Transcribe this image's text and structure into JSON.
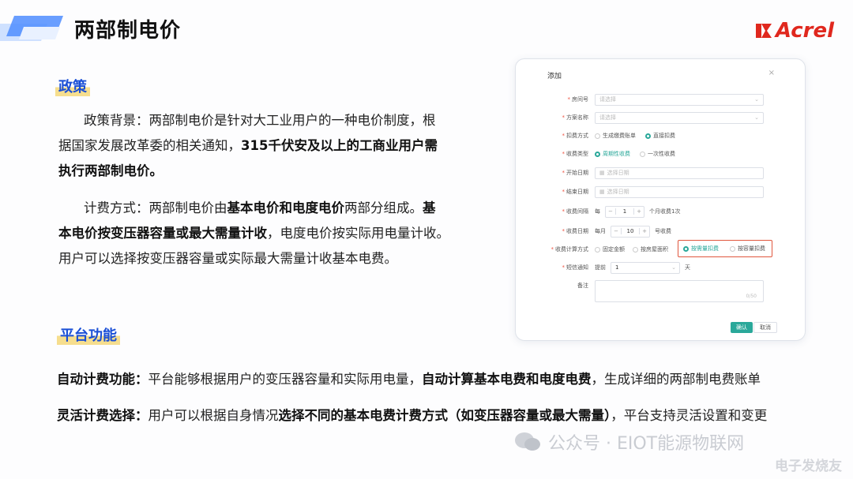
{
  "page": {
    "title": "两部制电价",
    "logo": "Acrel"
  },
  "policy": {
    "label": "政策",
    "p1_l1": "政策背景：两部制电价是针对大工业用户的一种电价制度，根",
    "p1_l2a": "据国家发展改革委的相关通知，",
    "p1_l2b": "315千伏安及以上的工商业用户需",
    "p1_l3": "执行两部制电价。",
    "p2_l1a": "计费方式：两部制电价由",
    "p2_l1b": "基本电价和电度电价",
    "p2_l1c": "两部分组成。",
    "p2_l1d": "基",
    "p2_l2a": "本电价按变压器容量或最大需量计收",
    "p2_l2b": "，电度电价按实际用电量计收。",
    "p2_l3": "用户可以选择按变压器容量或实际最大需量计收基本电费。"
  },
  "platform": {
    "label": "平台功能",
    "f1a": "自动计费功能：",
    "f1b": "平台能够根据用户的变压器容量和实际用电量，",
    "f1c": "自动计算基本电费和电度电费",
    "f1d": "，生成详细的两部制电费账单",
    "f2a": "灵活计费选择：",
    "f2b": "用户可以根据自身情况",
    "f2c": "选择不同的基本电费计费方式（如变压器容量或最大需量）",
    "f2d": "，平台支持灵活设置和变更"
  },
  "form": {
    "title": "添加",
    "close": "×",
    "room_label": "房间号",
    "room_placeholder": "请选择",
    "plan_label": "方案名称",
    "plan_placeholder": "请选择",
    "deduct_label": "扣费方式",
    "deduct_opt1": "生成缴费账单",
    "deduct_opt2": "直接扣费",
    "type_label": "收费类型",
    "type_opt1": "周期性收费",
    "type_opt2": "一次性收费",
    "start_label": "开始日期",
    "start_placeholder": "选择日期",
    "end_label": "结束日期",
    "end_placeholder": "选择日期",
    "interval_label": "收费间隔",
    "interval_prefix": "每",
    "interval_value": "1",
    "interval_suffix": "个月收费1次",
    "day_label": "收费日期",
    "day_prefix": "每月",
    "day_value": "10",
    "day_suffix": "号收费",
    "calc_label": "收费计算方式",
    "calc_opt1": "固定金额",
    "calc_opt2": "按房屋面积",
    "calc_opt3": "按需量扣费",
    "calc_opt4": "按容量扣费",
    "sms_label": "短信通知",
    "sms_prefix": "提前",
    "sms_value": "1",
    "sms_suffix": "天",
    "note_label": "备注",
    "note_count": "0/50",
    "confirm": "确认",
    "cancel": "取消",
    "accent": "#2aa89a",
    "highlight": "#e0573e"
  },
  "watermark": {
    "text": "公众号 · EIOT能源物联网",
    "site": "电子发烧友"
  }
}
